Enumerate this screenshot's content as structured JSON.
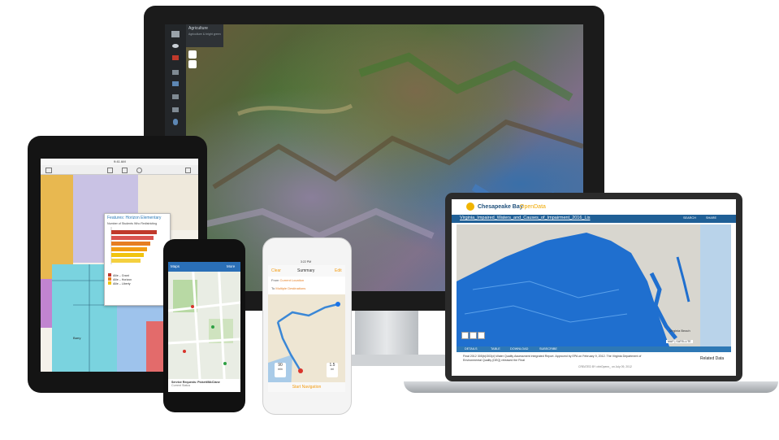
{
  "monitor": {
    "panel_title": "Agriculture",
    "panel_subtitle": "Agriculture & bright green"
  },
  "tablet": {
    "status_time": "9:41 AM",
    "popup_title": "Features: Horizon Elementary",
    "popup_subtitle": "Number of Students Who Redistricting",
    "legend": [
      {
        "label": "Allie – Grant",
        "color": "#c0392b"
      },
      {
        "label": "Allie – Horizon",
        "color": "#e67e22"
      },
      {
        "label": "Allie – Liberty",
        "color": "#f1c40f"
      }
    ],
    "map_label": "Barry"
  },
  "phone1": {
    "nav_left": "Maps",
    "nav_right": "More",
    "card_title": "Service Requests: Pickett/McClane",
    "card_sub": "Current Status"
  },
  "phone2": {
    "status_time": "3:22 PM",
    "nav_left": "Clear",
    "nav_title": "Summary",
    "nav_right": "Edit",
    "row_from_label": "From",
    "row_from_value": "Current Location",
    "row_to_label": "To",
    "row_to_value": "Multiple Destinations",
    "badge_left": "90",
    "badge_left_unit": "min",
    "badge_right": "1.5",
    "badge_right_unit": "mi",
    "start_label": "Start Navigation"
  },
  "laptop": {
    "brand": "Chesapeake Bay",
    "brand_accent": "OpenData",
    "nav_search": "SEARCH",
    "nav_share": "SHARE",
    "layer_title": "Virginia_Impaired_Waters_and_Causes_of_Impairment_2016_Lis",
    "tabs": [
      "DETAILS",
      "TABLE",
      "DOWNLOAD",
      "SUBSCRIBE"
    ],
    "map_city": "Virginia Beach",
    "map_toggle": "MAP | SATELLITE",
    "description": "Final 2012 305(b)/303(d) Water Quality Assessment Integrated Report. Approved by EPA on February 9, 2012. The Virginia Department of Environmental Quality (DEQ) released the Final",
    "created_by": "CREATED BY cbtrOpenn_ on July 09, 2012",
    "related": "Related Data"
  },
  "colors": {
    "laptop_title_bar": "#1f5f96",
    "phone1_bar": "#2a6fb7",
    "phone2_accent": "#f39c12",
    "water_blue": "#1f6fcf"
  }
}
